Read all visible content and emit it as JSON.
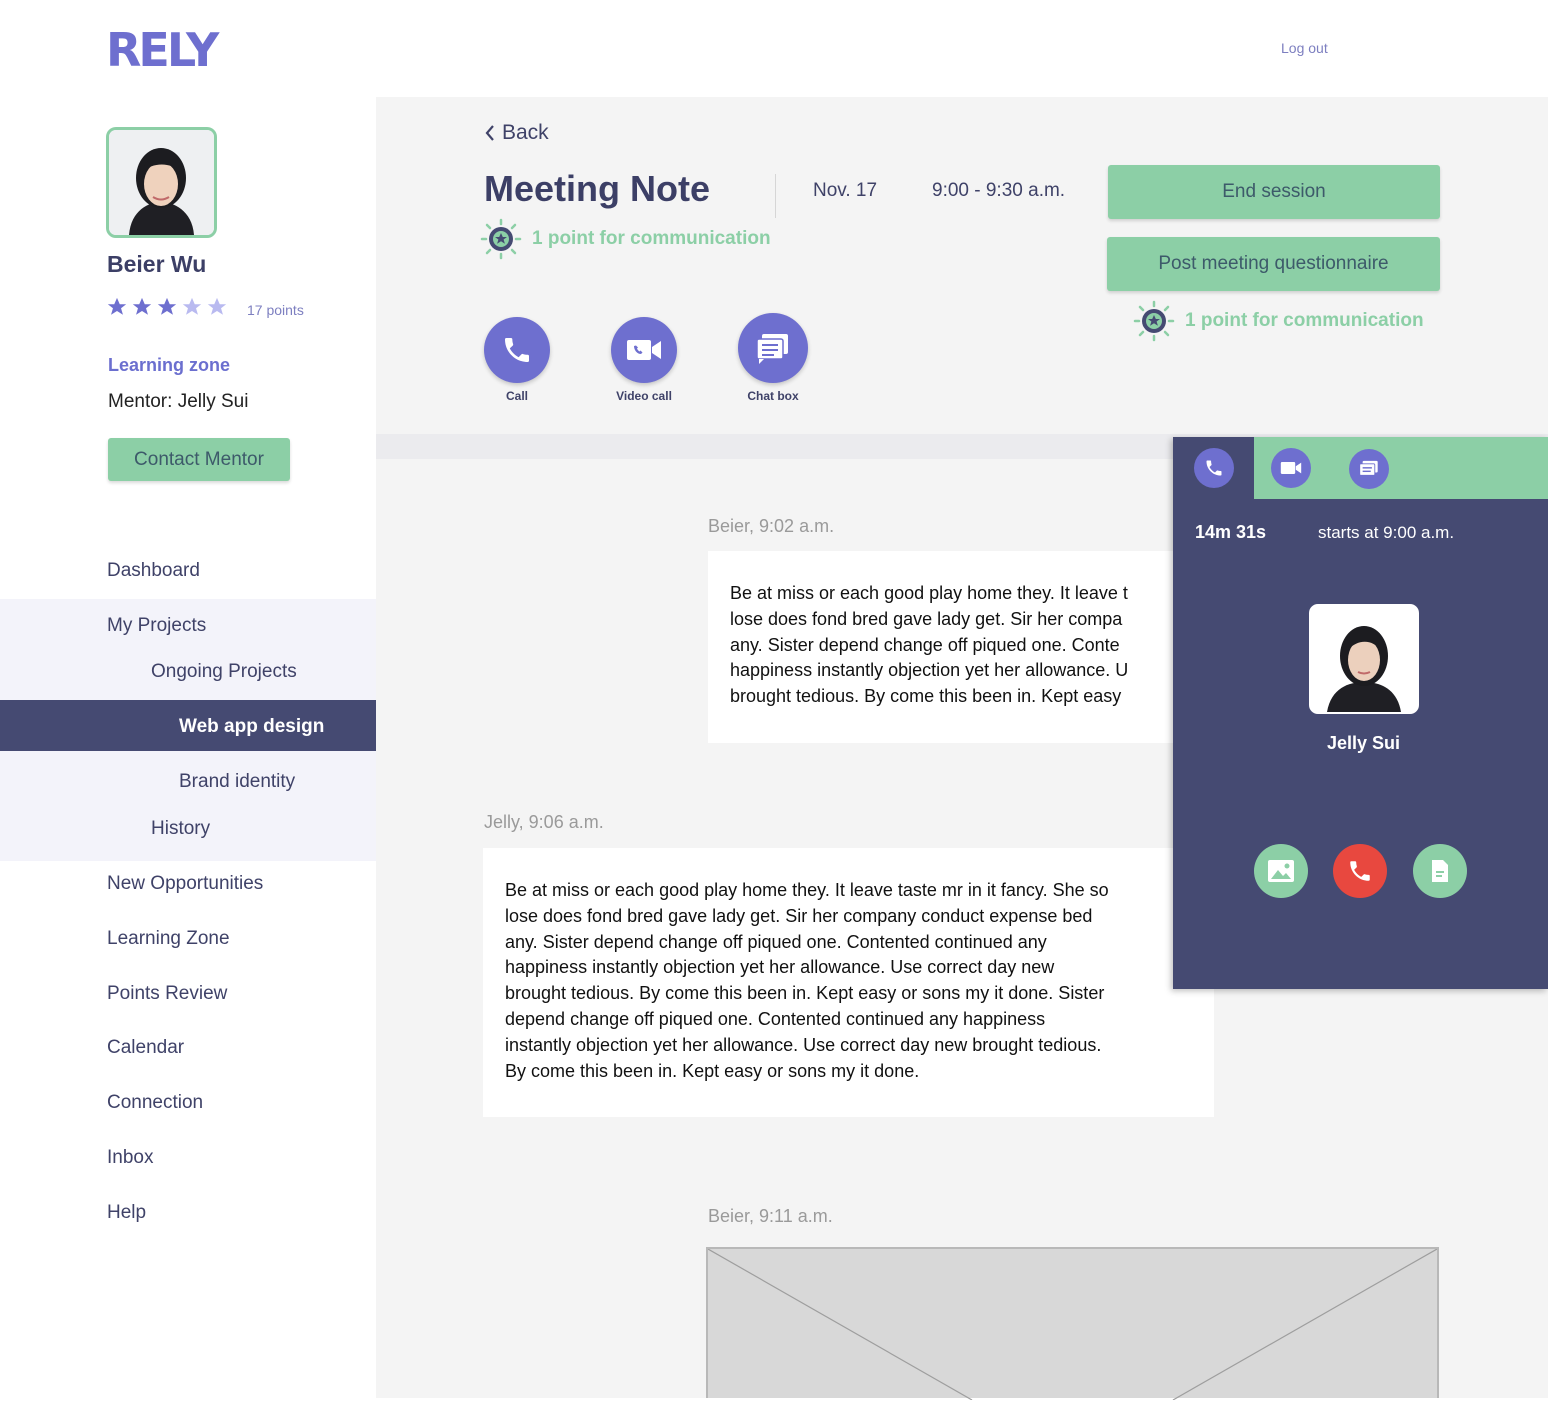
{
  "header": {
    "logo": "RELY",
    "logout": "Log out"
  },
  "profile": {
    "name": "Beier Wu",
    "rating": 3,
    "rating_max": 5,
    "points": "17 points",
    "learning_zone": "Learning zone",
    "mentor": "Mentor: Jelly Sui",
    "contact_button": "Contact Mentor"
  },
  "nav": {
    "dashboard": "Dashboard",
    "my_projects": "My Projects",
    "ongoing_projects": "Ongoing Projects",
    "web_app_design": "Web app design",
    "brand_identity": "Brand identity",
    "history": "History",
    "new_opportunities": "New Opportunities",
    "learning_zone": "Learning Zone",
    "points_review": "Points Review",
    "calendar": "Calendar",
    "connection": "Connection",
    "inbox": "Inbox",
    "help": "Help"
  },
  "meeting": {
    "back": "Back",
    "title": "Meeting Note",
    "date": "Nov. 17",
    "time": "9:00 - 9:30 a.m.",
    "point_note": "1 point for communication",
    "end_session": "End session",
    "post_questionnaire": "Post meeting questionnaire",
    "post_point_note": "1 point for communication",
    "actions": {
      "call": "Call",
      "video": "Video call",
      "chat": "Chat box"
    }
  },
  "messages": [
    {
      "meta": "Beier, 9:02 a.m.",
      "lines": [
        "Be at miss or each good play home they. It leave t",
        "lose does fond bred gave lady get. Sir her compa",
        "any. Sister depend change off piqued one. Conte",
        "happiness instantly objection yet her allowance. U",
        "brought tedious. By come this been in. Kept easy"
      ]
    },
    {
      "meta": "Jelly, 9:06 a.m.",
      "lines": [
        "Be at miss or each good play home they. It leave taste mr in it fancy. She so",
        "lose does fond bred gave lady get. Sir her company conduct expense bed",
        "any. Sister depend change off piqued one. Contented continued any",
        "happiness instantly objection yet her allowance. Use correct day new",
        "brought tedious. By come this been in. Kept easy or sons my it done. Sister",
        "depend change off piqued one. Contented continued any happiness",
        "instantly objection yet her allowance. Use correct day new brought tedious.",
        "By come this been in. Kept easy or sons my it done."
      ]
    },
    {
      "meta": "Beier, 9:11 a.m."
    }
  ],
  "call_panel": {
    "duration": "14m 31s",
    "starts": "starts at 9:00 a.m.",
    "contact_name": "Jelly Sui"
  },
  "colors": {
    "accent_purple": "#6e6fcf",
    "navy": "#454a72",
    "green": "#8ccfa6",
    "hangup_red": "#e8483f"
  }
}
